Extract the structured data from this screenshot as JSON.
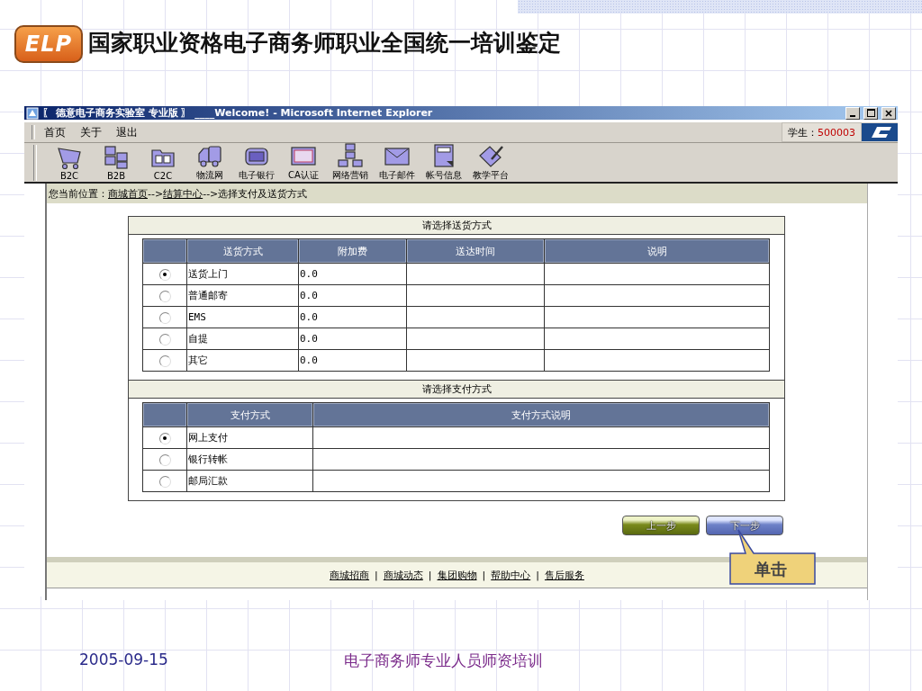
{
  "slide": {
    "logo": "ELP",
    "title": "国家职业资格电子商务师职业全国统一培训鉴定",
    "date": "2005-09-15",
    "footer": "电子商务师专业人员师资培训"
  },
  "window": {
    "title": "〖 德意电子商务实验室 专业版 〗 ____Welcome! - Microsoft Internet Explorer"
  },
  "menu": [
    "首页",
    "关于",
    "退出"
  ],
  "user": {
    "label": "学生：",
    "id": "500003"
  },
  "toolbar": [
    {
      "label": "B2C",
      "kind": "cart"
    },
    {
      "label": "B2B",
      "kind": "blocks"
    },
    {
      "label": "C2C",
      "kind": "folder"
    },
    {
      "label": "物流网",
      "kind": "truck"
    },
    {
      "label": "电子银行",
      "kind": "wallet"
    },
    {
      "label": "CA认证",
      "kind": "card"
    },
    {
      "label": "网络营销",
      "kind": "tree"
    },
    {
      "label": "电子邮件",
      "kind": "mail"
    },
    {
      "label": "帐号信息",
      "kind": "help"
    },
    {
      "label": "教学平台",
      "kind": "pen"
    }
  ],
  "breadcrumb": [
    {
      "text": "您当前位置：",
      "kind": "text"
    },
    {
      "text": "商城首页",
      "kind": "link"
    },
    {
      "text": "-->",
      "kind": "text"
    },
    {
      "text": "结算中心",
      "kind": "link"
    },
    {
      "text": "-->选择支付及送货方式",
      "kind": "text"
    }
  ],
  "shipping": {
    "heading": "请选择送货方式",
    "columns": [
      "送货方式",
      "附加费",
      "送达时间",
      "说明"
    ],
    "rows": [
      {
        "selected": true,
        "method": "送货上门",
        "fee": "0.0"
      },
      {
        "selected": false,
        "method": "普通邮寄",
        "fee": "0.0"
      },
      {
        "selected": false,
        "method": "EMS",
        "fee": "0.0"
      },
      {
        "selected": false,
        "method": "自提",
        "fee": "0.0"
      },
      {
        "selected": false,
        "method": "其它",
        "fee": "0.0"
      }
    ]
  },
  "payment": {
    "heading": "请选择支付方式",
    "columns": [
      "支付方式",
      "支付方式说明"
    ],
    "rows": [
      {
        "selected": true,
        "method": "网上支付"
      },
      {
        "selected": false,
        "method": "银行转帐"
      },
      {
        "selected": false,
        "method": "邮局汇款"
      }
    ]
  },
  "buttons": [
    {
      "label": "上一步",
      "kind": "back"
    },
    {
      "label": "下一步",
      "kind": "next"
    }
  ],
  "footer_links": [
    {
      "text": "商城招商",
      "kind": "link"
    },
    {
      "text": "|",
      "kind": "separator"
    },
    {
      "text": "商城动态",
      "kind": "link"
    },
    {
      "text": "|",
      "kind": "separator"
    },
    {
      "text": "集团购物",
      "kind": "link"
    },
    {
      "text": "|",
      "kind": "separator"
    },
    {
      "text": "帮助中心",
      "kind": "link"
    },
    {
      "text": "|",
      "kind": "separator"
    },
    {
      "text": "售后服务",
      "kind": "link"
    }
  ],
  "callout": "单击"
}
